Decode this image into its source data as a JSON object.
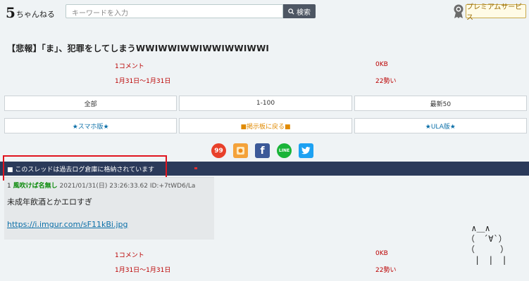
{
  "header": {
    "logo_main": "5",
    "logo_sub": "ちゃんねる",
    "search_placeholder": "キーワードを入力",
    "search_button": "検索",
    "premium_label": "プレミアムサービス"
  },
  "thread": {
    "title": "【悲報】「ま」、犯罪をしてしまうWWIWWIWWIWWIWWIWWI",
    "comments": "1コメント",
    "size": "0KB",
    "date_range": "1月31日～1月31日",
    "momentum": "22勢い"
  },
  "nav_row1": [
    "全部",
    "1-100",
    "最新50"
  ],
  "nav_row2": [
    "★スマホ版★",
    "■掲示板に戻る■",
    "★ULA版★"
  ],
  "share_icons": [
    "5ch-icon",
    "bookmark-icon",
    "facebook-icon",
    "line-icon",
    "twitter-icon"
  ],
  "share_labels": {
    "first": "99",
    "line": "LINE"
  },
  "archive_notice": "■ このスレッドは過去ログ倉庫に格納されています",
  "post": {
    "number": "1",
    "name": "風吹けば名無し",
    "date": "2021/01/31(日) 23:26:33.62 ID:+7tWD6/La",
    "body": "未成年飲酒とかエロすぎ",
    "link": "https://i.imgur.com/sF11kBi.jpg"
  },
  "ascii_art": " ∧＿∧\n（　´∀`）\n（　　　）\n　|　|　|",
  "colors": {
    "accent_red": "#b00000",
    "bar_navy": "#2b3a5a",
    "highlight_box": "#e0141e"
  }
}
